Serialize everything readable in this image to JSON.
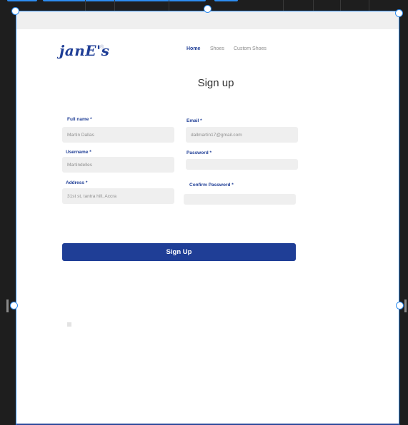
{
  "header": {
    "logo": "janE's",
    "logo_mark": "®",
    "nav": [
      "Home",
      "Shoes",
      "Custom Shoes"
    ]
  },
  "form": {
    "title": "Sign up",
    "fields": {
      "full_name": {
        "label": "Full name *",
        "value": "Martin Dallas"
      },
      "email": {
        "label": "Email *",
        "value": "dallmartin17@gmail.com"
      },
      "username": {
        "label": "Username *",
        "value": "Martindelles"
      },
      "password": {
        "label": "Password *",
        "value": ""
      },
      "address": {
        "label": "Address *",
        "value": "31st st, tantra hill, Accra"
      },
      "confirm_password": {
        "label": "Confirm Password *",
        "value": ""
      }
    },
    "submit": "Sign Up"
  },
  "colors": {
    "brand": "#1f3e96",
    "selection": "#2d8cf0",
    "input_bg": "#efefef"
  }
}
